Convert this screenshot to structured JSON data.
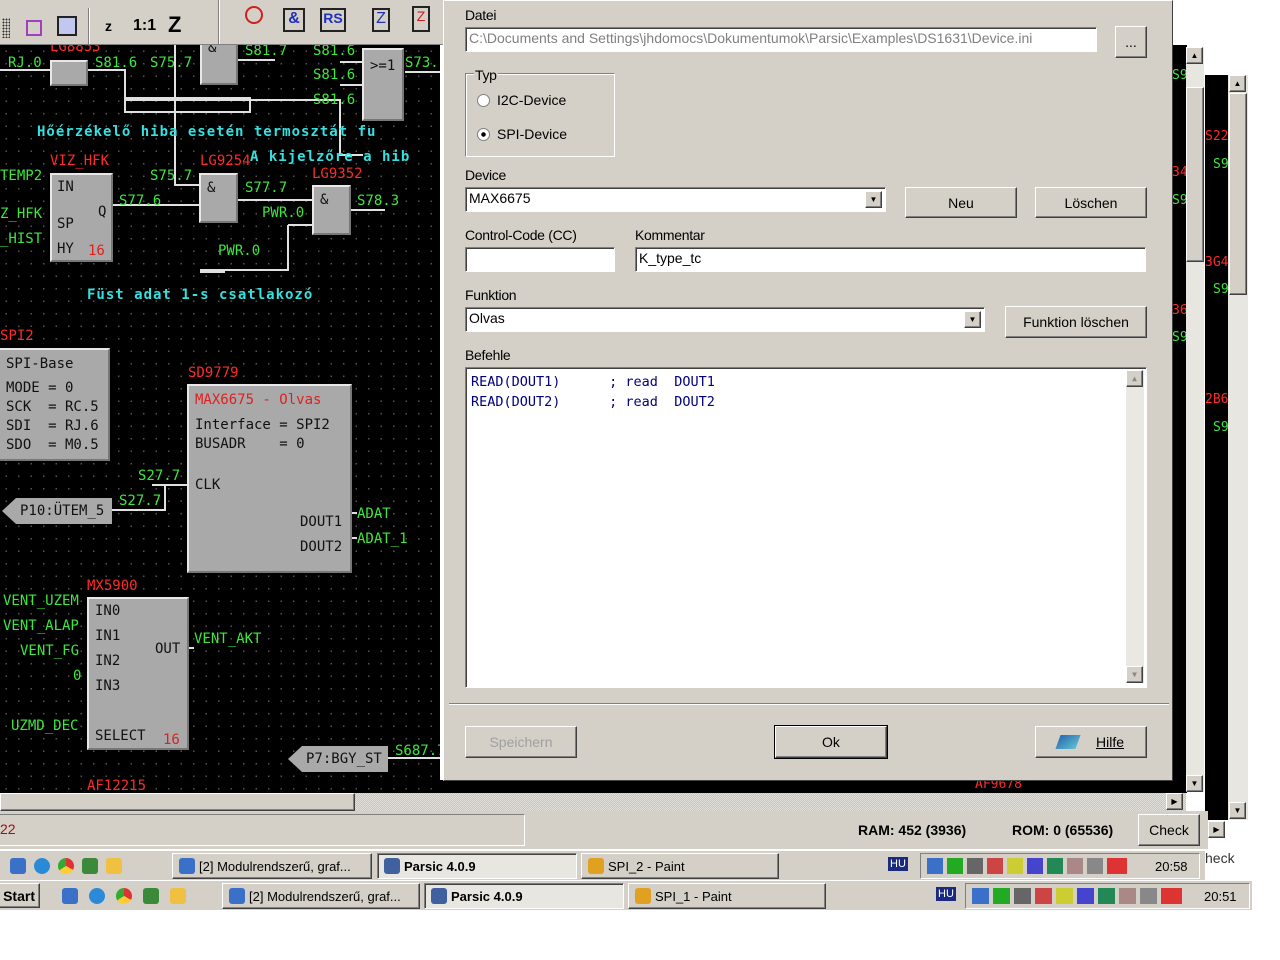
{
  "toolbar": {
    "zoom_small": "z",
    "zoom_1_1": "1:1",
    "zoom_big": "Z",
    "icons": [
      "grid-icon",
      "connector-icon",
      "component-icon",
      "timer-icon",
      "and-gate-icon",
      "rs-flipflop-icon",
      "counter-icon",
      "counter-vr-icon"
    ],
    "rs_label": "RS",
    "and_label": "&"
  },
  "schematic": {
    "labels": [
      "LG8853",
      "RJ.0",
      "S81.6",
      "S75.7",
      "S81.7",
      "S81.6",
      "S81.6",
      "S81.6",
      "S73.",
      "Hőérzékelő hiba esetén termosztát fu",
      "VIZ_HFK",
      "LG9254",
      "A kijelzőre a hib",
      "LG9352",
      "TEMP2",
      "S75.7",
      "S77.6",
      "S77.7",
      "PWR.0",
      "S78.3",
      "Z_HFK",
      "_HIST",
      "PWR.0",
      "Füst adat 1-s csatlakozó",
      "SPI2",
      "SD9779",
      "S27.7",
      "S27.7",
      "ADAT",
      "ADAT_1",
      "MX5900",
      "VENT_UZEM",
      "VENT_ALAP",
      "VENT_FG",
      "0",
      "UZMD_DEC",
      "VENT_AKT",
      "S687.7",
      "AF12215",
      "AF9678"
    ],
    "gates": {
      "and": "&",
      "or": ">=1"
    },
    "hyst": {
      "in": "IN",
      "sp": "SP",
      "hy": "HY",
      "q": "Q",
      "num": "16"
    },
    "spi_base": {
      "title": "SPI-Base",
      "lines": [
        "MODE = 0",
        "SCK  = RC.5",
        "SDI  = RJ.6",
        "SDO  = M0.5"
      ]
    },
    "max": {
      "title": "MAX6675 - Olvas",
      "lines": [
        "Interface = SPI2",
        "BUSADR    = 0"
      ],
      "clk": "CLK",
      "dout1": "DOUT1",
      "dout2": "DOUT2"
    },
    "mux": {
      "in0": "IN0",
      "in1": "IN1",
      "in2": "IN2",
      "in3": "IN3",
      "out": "OUT",
      "select": "SELECT",
      "num": "16"
    },
    "tags": [
      "P10:ÜTEM_5",
      "P7:BGY_ST"
    ],
    "right_labels": [
      "S9",
      "34",
      "S9",
      "36",
      "S9",
      "S22",
      "S9",
      "3G4",
      "S9",
      "2B6",
      "S9"
    ]
  },
  "dialog": {
    "datei_label": "Datei",
    "datei_value": "C:\\Documents and Settings\\jhdomocs\\Dokumentumok\\Parsic\\Examples\\DS1631\\Device.ini",
    "browse": "...",
    "typ_label": "Typ",
    "radio_i2c": "I2C-Device",
    "radio_spi": "SPI-Device",
    "selected_type": "SPI-Device",
    "device_label": "Device",
    "device_value": "MAX6675",
    "neu": "Neu",
    "loeschen": "Löschen",
    "cc_label": "Control-Code (CC)",
    "cc_value": "",
    "kommentar_label": "Kommentar",
    "kommentar_value": "K_type_tc",
    "funktion_label": "Funktion",
    "funktion_value": "Olvas",
    "funktion_loeschen": "Funktion löschen",
    "befehle_label": "Befehle",
    "befehle_lines": [
      "READ(DOUT1)      ; read  DOUT1",
      "READ(DOUT2)      ; read  DOUT2"
    ],
    "speichern": "Speichern",
    "ok": "Ok",
    "hilfe": "Hilfe"
  },
  "status": {
    "line": "22",
    "ram": "RAM: 452 (3936)",
    "rom": "ROM: 0 (65536)",
    "check": "Check",
    "check2": "heck"
  },
  "taskbar1": {
    "tasks": [
      "[2] Modulrendszerű, graf...",
      "Parsic 4.0.9",
      "SPI_2 - Paint"
    ],
    "lang": "HU",
    "time": "20:58"
  },
  "taskbar2": {
    "start": "Start",
    "tasks": [
      "[2] Modulrendszerű, graf...",
      "Parsic 4.0.9",
      "SPI_1 - Paint"
    ],
    "lang": "HU",
    "time": "20:51"
  },
  "colors": {
    "wire": "#e0e0e0",
    "signal_green": "#3ee63e",
    "block_id_red": "#ff2a2a",
    "comment_cyan": "#35e0e0",
    "face": "#d4d0c8",
    "code_blue": "#000080"
  }
}
